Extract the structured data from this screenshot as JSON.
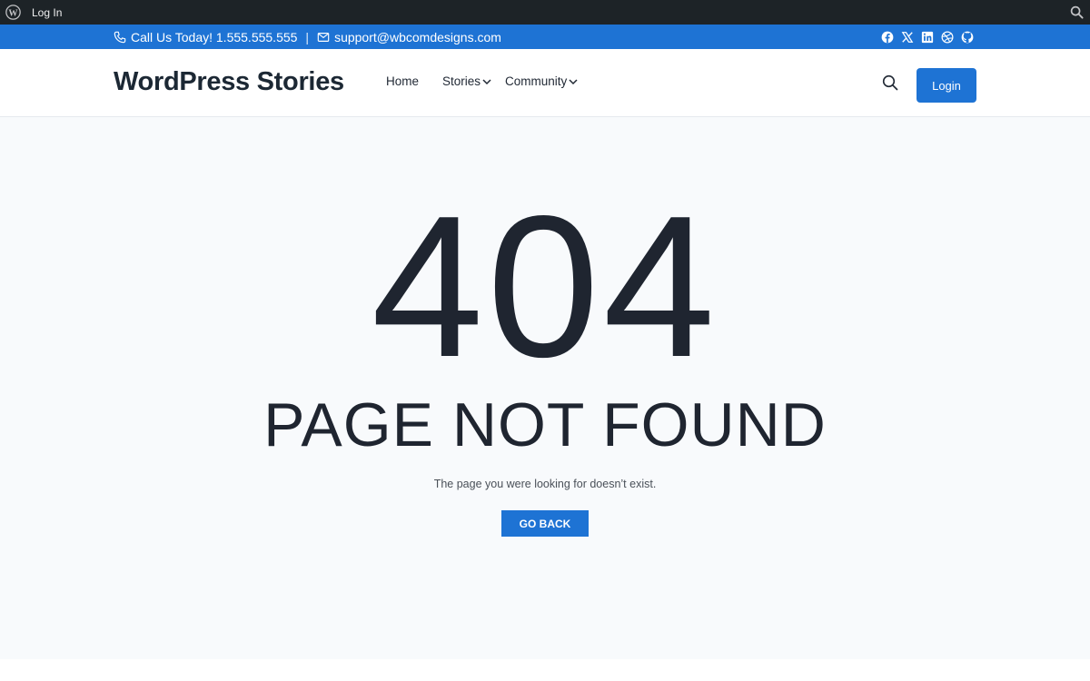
{
  "adminbar": {
    "wp_icon": "wordpress-icon",
    "login_label": "Log In",
    "search_icon": "search-icon"
  },
  "topbar": {
    "phone_text": "Call Us Today! 1.555.555.555",
    "separator": "|",
    "email_text": "support@wbcomdesigns.com",
    "socials": [
      "facebook-icon",
      "x-icon",
      "linkedin-icon",
      "dribbble-icon",
      "github-icon"
    ]
  },
  "header": {
    "brand": "WordPress Stories",
    "nav": [
      {
        "label": "Home",
        "dropdown": false
      },
      {
        "label": "Stories",
        "dropdown": true
      },
      {
        "label": "Community",
        "dropdown": true
      }
    ],
    "login_label": "Login"
  },
  "main": {
    "code": "404",
    "title": "PAGE NOT FOUND",
    "description": "The page you were looking for doesn’t exist.",
    "button_label": "GO BACK"
  },
  "colors": {
    "accent": "#1e73d4",
    "admin_bar": "#1d2327",
    "text_dark": "#1f2530",
    "background": "#f8fafc"
  }
}
